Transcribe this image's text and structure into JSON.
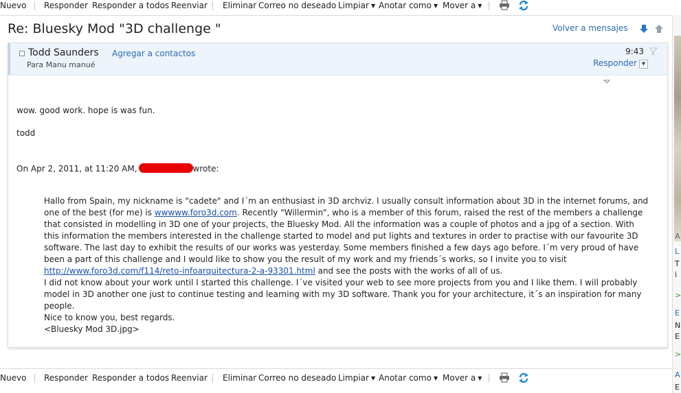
{
  "toolbar": {
    "new_label": "Nuevo",
    "reply_label": "Responder",
    "reply_all_label": "Responder a todos",
    "forward_label": "Reenviar",
    "delete_label": "Eliminar",
    "junk_label": "Correo no deseado",
    "sweep_label": "Limpiar",
    "mark_as_label": "Anotar como",
    "move_to_label": "Mover a"
  },
  "message": {
    "subject": "Re: Bluesky Mod \"3D challenge \"",
    "back_label": "Volver a mensajes",
    "sender": "Todd Saunders",
    "add_contact_label": "Agregar a contactos",
    "to_line": "Para Manu manué",
    "time": "9:43",
    "reply_label": "Responder",
    "body": {
      "line1": "wow.  good work.  hope is was fun.",
      "line2": "todd",
      "attribution_prefix": "On Apr 2, 2011, at 11:20 AM,",
      "attribution_suffix": "wrote:"
    },
    "quote": {
      "p1_a": "Hallo from Spain, my nickname is \"cadete\" and I´m an enthusiast in 3D archviz. I usually consult information about 3D in the internet forums, and one of the best (for me) is ",
      "link1": "wwwww.foro3d.com",
      "p1_b": ". Recently \"Willermin\", who is a member of this forum, raised the rest of the members a challenge that consisted in modelling in 3D one of your projects, the Bluesky Mod. All the information was a couple of photos and a jpg of a section. With this information the members interested in the challenge started to model and put lights and textures in order to practise with our favourite 3D software. The last day to exhibit the results of our works was yesterday. Some members finished a few days ago before. I´m very proud of have been a part of this challenge and I would like to show you the result of my work and my friends´s works, so I invite you to visit ",
      "link2": "http://www.foro3d.com/f114/reto-infoarquitectura-2-a-93301.html",
      "p1_c": " and see the posts with the works of all of us.",
      "p2": "I did not know about your work until I started this challenge. I´ve visited your web to see more projects from you and I like them. I will probably model in 3D another one just to continue testing and learning with my 3D software. Thank you for your architecture, it´s an inspiration for many people.",
      "p3": "Nice to know you, best regards.",
      "p4": "<Bluesky Mod 3D.jpg>"
    }
  },
  "right_strip": {
    "chars": [
      "A",
      "L",
      "T",
      "i",
      ">",
      "E",
      "N",
      "E",
      ">",
      "A",
      "E"
    ]
  },
  "colors": {
    "link": "#2a6ab5",
    "header_bg": "#eef4fb",
    "redaction": "#e80000",
    "refresh_icon": "#1e8ad6"
  }
}
